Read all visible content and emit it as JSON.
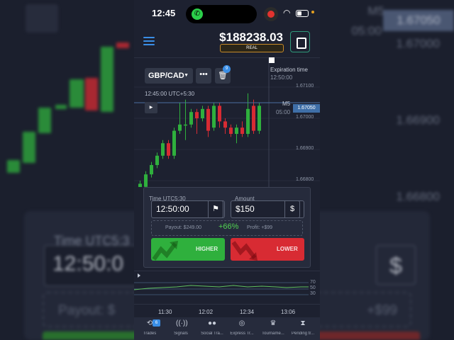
{
  "status_bar": {
    "time": "12:45"
  },
  "header": {
    "balance": "$188238.03",
    "account_type": "REAL"
  },
  "toolbar": {
    "pair": "GBP/CAD",
    "more_label": "•••",
    "badge_count": "9"
  },
  "chart": {
    "current_time": "12:45:00 UTC+5:30",
    "expiration_label": "Expiration time",
    "expiration_value": "12:50:00",
    "timeframe": "M5",
    "timer": "05:00",
    "current_price": "1.67050",
    "price_ticks": [
      "1.67100",
      "1.67000",
      "1.66900",
      "1.66800"
    ],
    "x_ticks": [
      "11:30",
      "12:02",
      "12:34",
      "13:06"
    ]
  },
  "chart_data": {
    "type": "candlestick",
    "y_ticks": [
      1.671,
      1.67,
      1.669,
      1.668
    ],
    "current": 1.6705,
    "candles": [
      {
        "o": 1.6677,
        "c": 1.6679,
        "h": 1.668,
        "l": 1.6676
      },
      {
        "o": 1.6678,
        "c": 1.6682,
        "h": 1.6683,
        "l": 1.6677
      },
      {
        "o": 1.6682,
        "c": 1.6685,
        "h": 1.6686,
        "l": 1.6681
      },
      {
        "o": 1.6685,
        "c": 1.6688,
        "h": 1.6689,
        "l": 1.6684
      },
      {
        "o": 1.6688,
        "c": 1.6692,
        "h": 1.6693,
        "l": 1.6687
      },
      {
        "o": 1.6692,
        "c": 1.6688,
        "h": 1.6693,
        "l": 1.6687
      },
      {
        "o": 1.6688,
        "c": 1.6696,
        "h": 1.6697,
        "l": 1.6687
      },
      {
        "o": 1.6696,
        "c": 1.6698,
        "h": 1.6705,
        "l": 1.6695
      },
      {
        "o": 1.6698,
        "c": 1.6698,
        "h": 1.6706,
        "l": 1.6693
      },
      {
        "o": 1.6698,
        "c": 1.6702,
        "h": 1.6703,
        "l": 1.6697
      },
      {
        "o": 1.6702,
        "c": 1.67,
        "h": 1.6703,
        "l": 1.6695
      },
      {
        "o": 1.67,
        "c": 1.6703,
        "h": 1.6704,
        "l": 1.6699
      },
      {
        "o": 1.6703,
        "c": 1.6696,
        "h": 1.6704,
        "l": 1.6694
      },
      {
        "o": 1.6697,
        "c": 1.6704,
        "h": 1.6705,
        "l": 1.6696
      },
      {
        "o": 1.6704,
        "c": 1.6699,
        "h": 1.6705,
        "l": 1.6697
      },
      {
        "o": 1.6699,
        "c": 1.6697,
        "h": 1.67,
        "l": 1.6695
      },
      {
        "o": 1.6697,
        "c": 1.6695,
        "h": 1.6698,
        "l": 1.6694
      },
      {
        "o": 1.6695,
        "c": 1.6697,
        "h": 1.6698,
        "l": 1.6692
      },
      {
        "o": 1.6697,
        "c": 1.6695,
        "h": 1.6699,
        "l": 1.6694
      },
      {
        "o": 1.6695,
        "c": 1.6703,
        "h": 1.6708,
        "l": 1.6694
      },
      {
        "o": 1.6704,
        "c": 1.6696,
        "h": 1.6706,
        "l": 1.6695
      },
      {
        "o": 1.6696,
        "c": 1.6704,
        "h": 1.6705,
        "l": 1.6695
      }
    ]
  },
  "trade_panel": {
    "time_label": "Time UTC5:30",
    "time_value": "12:50:00",
    "amount_label": "Amount",
    "amount_value": "$150",
    "currency_symbol": "$",
    "payout": "Payout: $249.00",
    "percent": "+66%",
    "profit": "Profit: +$99",
    "higher_label": "HIGHER",
    "lower_label": "LOWER"
  },
  "indicator": {
    "levels": [
      "70",
      "50",
      "30"
    ]
  },
  "bottom_nav": [
    {
      "label": "Trades",
      "icon": "history-icon",
      "glyph": "⟲",
      "badge": "6"
    },
    {
      "label": "Signals",
      "icon": "signal-icon",
      "glyph": "((·))"
    },
    {
      "label": "Social Tra...",
      "icon": "users-icon",
      "glyph": "●●"
    },
    {
      "label": "Express Tr...",
      "icon": "target-icon",
      "glyph": "◎"
    },
    {
      "label": "Tourname...",
      "icon": "trophy-icon",
      "glyph": "♛"
    },
    {
      "label": "Pending tr...",
      "icon": "hourglass-icon",
      "glyph": "⧗"
    }
  ],
  "background": {
    "timeframe": "M5",
    "timer": "05:00",
    "current_price": "1.67050",
    "price_ticks": [
      "1.67000",
      "1.66900",
      "1.66800"
    ],
    "time_label": "Time UTC5:3",
    "time_value": "12:50:0",
    "payout_prefix": "Payout: $",
    "profit_suffix": "+$99",
    "currency_symbol": "$"
  },
  "colors": {
    "up": "#2fb03d",
    "down": "#d82b33",
    "accent": "#3a8ee6",
    "bg": "#1d2130",
    "panel": "#262b3c"
  }
}
